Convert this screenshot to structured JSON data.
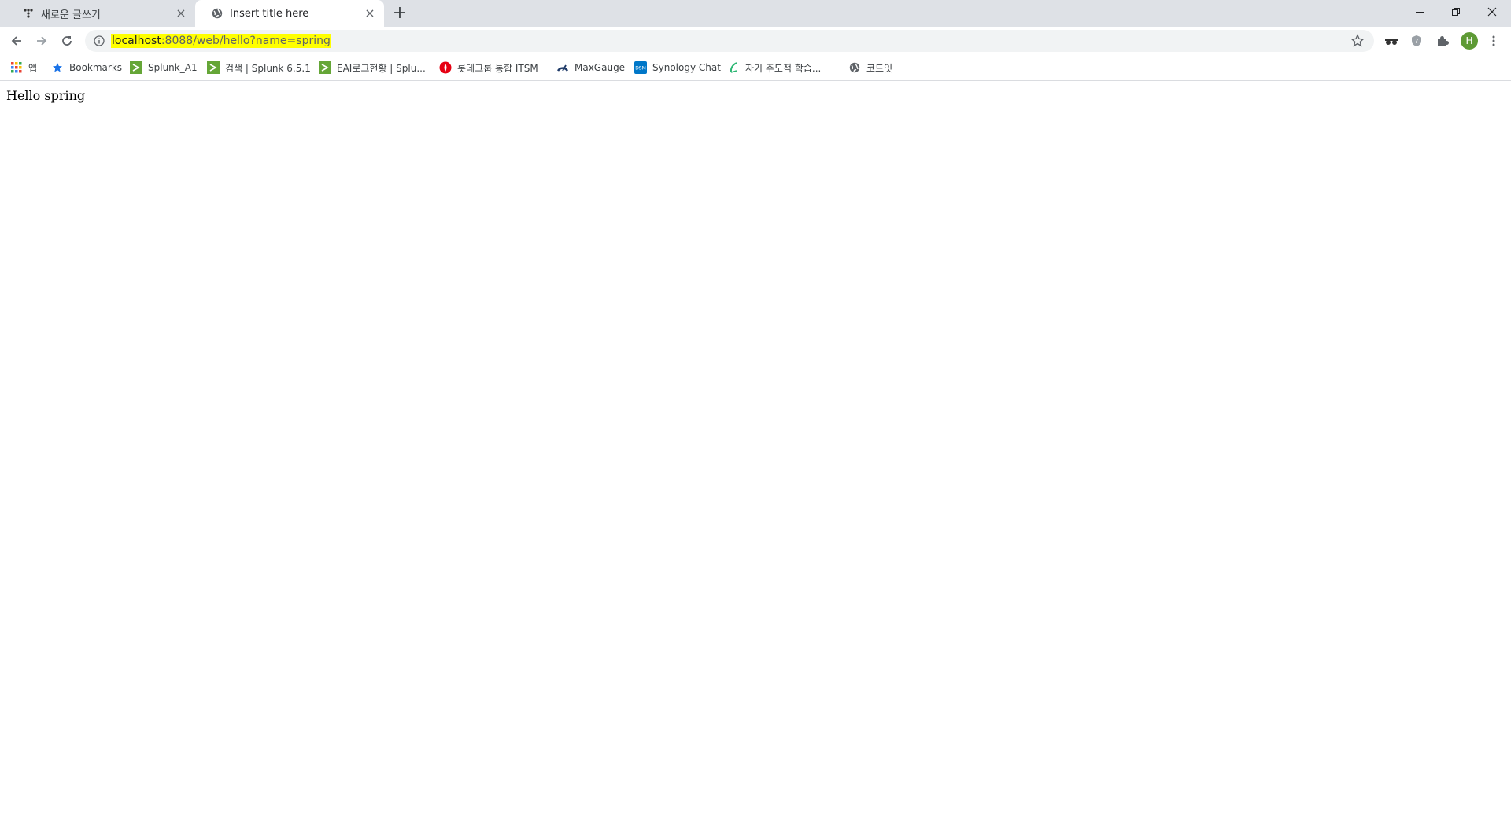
{
  "tabs": [
    {
      "title": "새로운 글쓰기",
      "active": false,
      "icon": "tistory-icon"
    },
    {
      "title": "Insert title here",
      "active": true,
      "icon": "globe-icon"
    }
  ],
  "address_bar": {
    "url_host": "localhost",
    "url_rest": ":8088/web/hello?name=spring",
    "highlight_color": "#ffff00"
  },
  "bookmarks": [
    {
      "label": "앱",
      "icon": "apps-grid-icon"
    },
    {
      "label": "Bookmarks",
      "icon": "star-icon"
    },
    {
      "label": "Splunk_A1",
      "icon": "splunk-icon"
    },
    {
      "label": "검색 | Splunk 6.5.1",
      "icon": "splunk-icon"
    },
    {
      "label": "EAI로그현황 | Splu...",
      "icon": "splunk-icon"
    },
    {
      "label": "롯데그룹 통합 ITSM",
      "icon": "lotte-icon"
    },
    {
      "label": "MaxGauge",
      "icon": "maxgauge-icon"
    },
    {
      "label": "Synology Chat",
      "icon": "dsm-icon"
    },
    {
      "label": "자기 주도적 학습...",
      "icon": "leaf-icon"
    },
    {
      "label": "코드잇",
      "icon": "globe-icon"
    }
  ],
  "profile": {
    "initial": "H",
    "color": "#5e9a35"
  },
  "page": {
    "text": "Hello spring"
  }
}
